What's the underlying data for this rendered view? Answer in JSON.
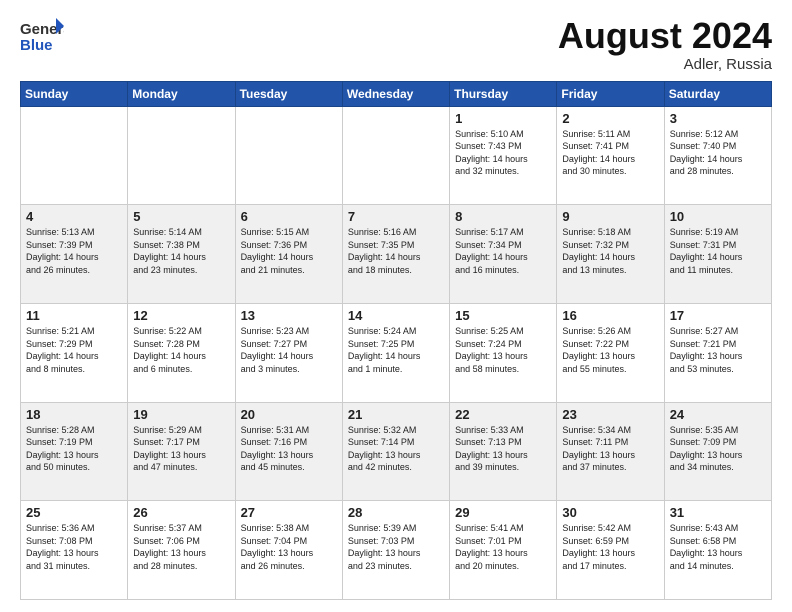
{
  "header": {
    "logo_general": "General",
    "logo_blue": "Blue",
    "month_year": "August 2024",
    "location": "Adler, Russia"
  },
  "days_of_week": [
    "Sunday",
    "Monday",
    "Tuesday",
    "Wednesday",
    "Thursday",
    "Friday",
    "Saturday"
  ],
  "weeks": [
    [
      {
        "day": "",
        "info": ""
      },
      {
        "day": "",
        "info": ""
      },
      {
        "day": "",
        "info": ""
      },
      {
        "day": "",
        "info": ""
      },
      {
        "day": "1",
        "info": "Sunrise: 5:10 AM\nSunset: 7:43 PM\nDaylight: 14 hours\nand 32 minutes."
      },
      {
        "day": "2",
        "info": "Sunrise: 5:11 AM\nSunset: 7:41 PM\nDaylight: 14 hours\nand 30 minutes."
      },
      {
        "day": "3",
        "info": "Sunrise: 5:12 AM\nSunset: 7:40 PM\nDaylight: 14 hours\nand 28 minutes."
      }
    ],
    [
      {
        "day": "4",
        "info": "Sunrise: 5:13 AM\nSunset: 7:39 PM\nDaylight: 14 hours\nand 26 minutes."
      },
      {
        "day": "5",
        "info": "Sunrise: 5:14 AM\nSunset: 7:38 PM\nDaylight: 14 hours\nand 23 minutes."
      },
      {
        "day": "6",
        "info": "Sunrise: 5:15 AM\nSunset: 7:36 PM\nDaylight: 14 hours\nand 21 minutes."
      },
      {
        "day": "7",
        "info": "Sunrise: 5:16 AM\nSunset: 7:35 PM\nDaylight: 14 hours\nand 18 minutes."
      },
      {
        "day": "8",
        "info": "Sunrise: 5:17 AM\nSunset: 7:34 PM\nDaylight: 14 hours\nand 16 minutes."
      },
      {
        "day": "9",
        "info": "Sunrise: 5:18 AM\nSunset: 7:32 PM\nDaylight: 14 hours\nand 13 minutes."
      },
      {
        "day": "10",
        "info": "Sunrise: 5:19 AM\nSunset: 7:31 PM\nDaylight: 14 hours\nand 11 minutes."
      }
    ],
    [
      {
        "day": "11",
        "info": "Sunrise: 5:21 AM\nSunset: 7:29 PM\nDaylight: 14 hours\nand 8 minutes."
      },
      {
        "day": "12",
        "info": "Sunrise: 5:22 AM\nSunset: 7:28 PM\nDaylight: 14 hours\nand 6 minutes."
      },
      {
        "day": "13",
        "info": "Sunrise: 5:23 AM\nSunset: 7:27 PM\nDaylight: 14 hours\nand 3 minutes."
      },
      {
        "day": "14",
        "info": "Sunrise: 5:24 AM\nSunset: 7:25 PM\nDaylight: 14 hours\nand 1 minute."
      },
      {
        "day": "15",
        "info": "Sunrise: 5:25 AM\nSunset: 7:24 PM\nDaylight: 13 hours\nand 58 minutes."
      },
      {
        "day": "16",
        "info": "Sunrise: 5:26 AM\nSunset: 7:22 PM\nDaylight: 13 hours\nand 55 minutes."
      },
      {
        "day": "17",
        "info": "Sunrise: 5:27 AM\nSunset: 7:21 PM\nDaylight: 13 hours\nand 53 minutes."
      }
    ],
    [
      {
        "day": "18",
        "info": "Sunrise: 5:28 AM\nSunset: 7:19 PM\nDaylight: 13 hours\nand 50 minutes."
      },
      {
        "day": "19",
        "info": "Sunrise: 5:29 AM\nSunset: 7:17 PM\nDaylight: 13 hours\nand 47 minutes."
      },
      {
        "day": "20",
        "info": "Sunrise: 5:31 AM\nSunset: 7:16 PM\nDaylight: 13 hours\nand 45 minutes."
      },
      {
        "day": "21",
        "info": "Sunrise: 5:32 AM\nSunset: 7:14 PM\nDaylight: 13 hours\nand 42 minutes."
      },
      {
        "day": "22",
        "info": "Sunrise: 5:33 AM\nSunset: 7:13 PM\nDaylight: 13 hours\nand 39 minutes."
      },
      {
        "day": "23",
        "info": "Sunrise: 5:34 AM\nSunset: 7:11 PM\nDaylight: 13 hours\nand 37 minutes."
      },
      {
        "day": "24",
        "info": "Sunrise: 5:35 AM\nSunset: 7:09 PM\nDaylight: 13 hours\nand 34 minutes."
      }
    ],
    [
      {
        "day": "25",
        "info": "Sunrise: 5:36 AM\nSunset: 7:08 PM\nDaylight: 13 hours\nand 31 minutes."
      },
      {
        "day": "26",
        "info": "Sunrise: 5:37 AM\nSunset: 7:06 PM\nDaylight: 13 hours\nand 28 minutes."
      },
      {
        "day": "27",
        "info": "Sunrise: 5:38 AM\nSunset: 7:04 PM\nDaylight: 13 hours\nand 26 minutes."
      },
      {
        "day": "28",
        "info": "Sunrise: 5:39 AM\nSunset: 7:03 PM\nDaylight: 13 hours\nand 23 minutes."
      },
      {
        "day": "29",
        "info": "Sunrise: 5:41 AM\nSunset: 7:01 PM\nDaylight: 13 hours\nand 20 minutes."
      },
      {
        "day": "30",
        "info": "Sunrise: 5:42 AM\nSunset: 6:59 PM\nDaylight: 13 hours\nand 17 minutes."
      },
      {
        "day": "31",
        "info": "Sunrise: 5:43 AM\nSunset: 6:58 PM\nDaylight: 13 hours\nand 14 minutes."
      }
    ]
  ]
}
